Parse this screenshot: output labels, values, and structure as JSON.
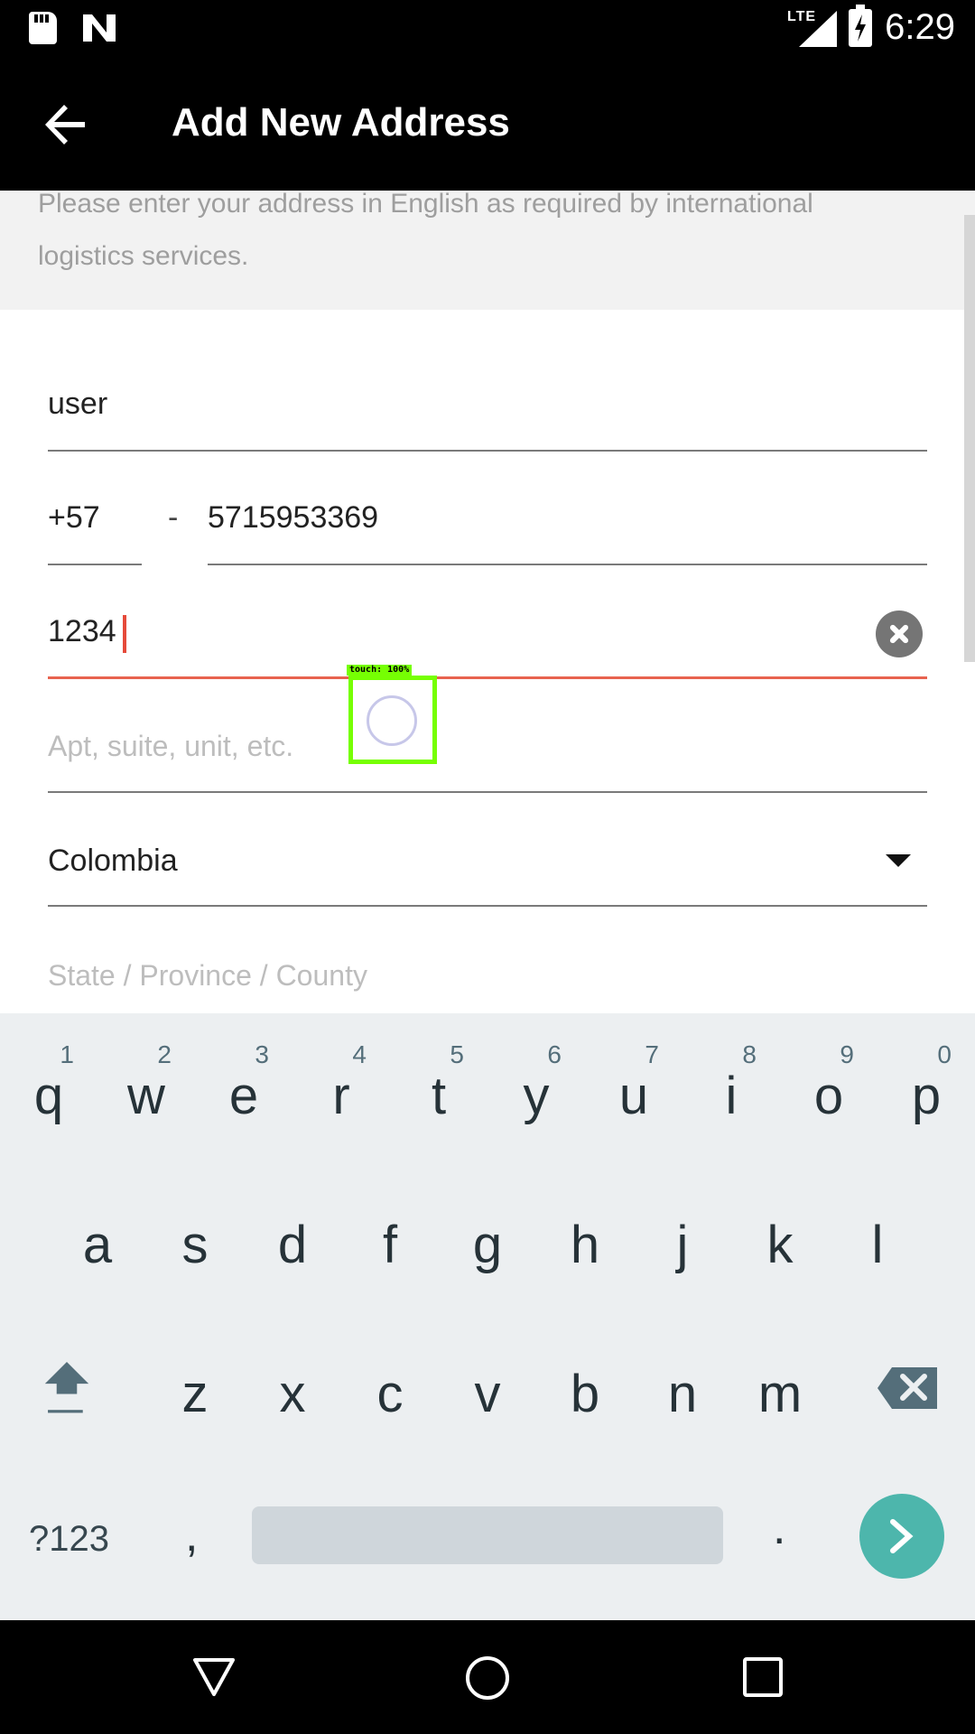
{
  "status_bar": {
    "time": "6:29",
    "network": "LTE",
    "icons": [
      "sd-card-icon",
      "n-icon",
      "signal-icon",
      "battery-charging-icon"
    ]
  },
  "app_bar": {
    "title": "Add New Address",
    "back_icon": "arrow-back-icon"
  },
  "info": {
    "text": "Please enter your address in English as required by international logistics services."
  },
  "form": {
    "name": {
      "value": "user"
    },
    "phone": {
      "country_code": "+57",
      "separator": "-",
      "number": "5715953369"
    },
    "street": {
      "value": "1234"
    },
    "apt": {
      "placeholder": "Apt, suite, unit, etc."
    },
    "country": {
      "value": "Colombia"
    },
    "state": {
      "placeholder": "State / Province / County"
    }
  },
  "touch_overlay": {
    "label": "touch: 100%"
  },
  "keyboard": {
    "row1": [
      {
        "ch": "q",
        "hint": "1"
      },
      {
        "ch": "w",
        "hint": "2"
      },
      {
        "ch": "e",
        "hint": "3"
      },
      {
        "ch": "r",
        "hint": "4"
      },
      {
        "ch": "t",
        "hint": "5"
      },
      {
        "ch": "y",
        "hint": "6"
      },
      {
        "ch": "u",
        "hint": "7"
      },
      {
        "ch": "i",
        "hint": "8"
      },
      {
        "ch": "o",
        "hint": "9"
      },
      {
        "ch": "p",
        "hint": "0"
      }
    ],
    "row2": [
      "a",
      "s",
      "d",
      "f",
      "g",
      "h",
      "j",
      "k",
      "l"
    ],
    "row3": [
      "z",
      "x",
      "c",
      "v",
      "b",
      "n",
      "m"
    ],
    "symbols_label": "?123",
    "comma": ",",
    "period": ".",
    "accent_color": "#4db6ac"
  },
  "nav_bar": {
    "icons": [
      "back-triangle-icon",
      "home-circle-icon",
      "recents-square-icon"
    ]
  }
}
